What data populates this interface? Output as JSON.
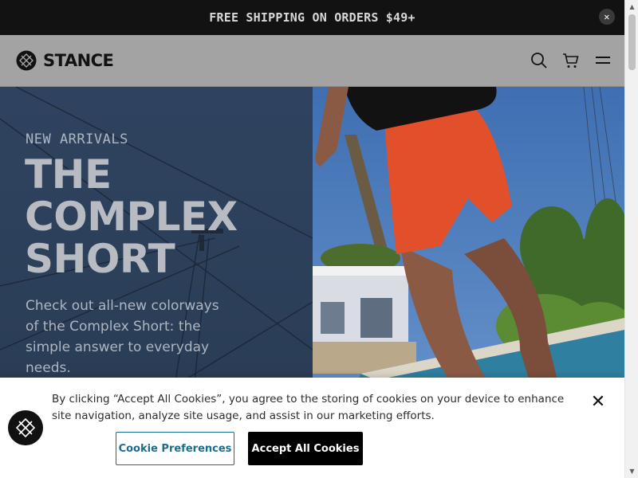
{
  "announcement": {
    "text": "FREE SHIPPING ON ORDERS $49+",
    "close_icon": "close-icon"
  },
  "header": {
    "brand": "STANCE",
    "icons": [
      "search-icon",
      "cart-icon",
      "menu-icon"
    ]
  },
  "hero": {
    "eyebrow": "NEW ARRIVALS",
    "title_lines": [
      "THE",
      "COMPLEX",
      "SHORT"
    ],
    "description": "Check out all-new colorways of the Complex Short: the simple answer to everyday needs."
  },
  "cookie_banner": {
    "text": "By clicking “Accept All Cookies”, you agree to the storing of cookies on your device to enhance site navigation, analyze site usage, and assist in our marketing efforts.",
    "preferences_label": "Cookie Preferences",
    "accept_label": "Accept All Cookies",
    "close_icon": "close-icon"
  },
  "colors": {
    "announcement_bg": "#121212",
    "header_bg": "#a3a3a3",
    "hero_left_bg": "#2f4360",
    "accent": "#1a6d8e",
    "accept_bg": "#000000"
  }
}
